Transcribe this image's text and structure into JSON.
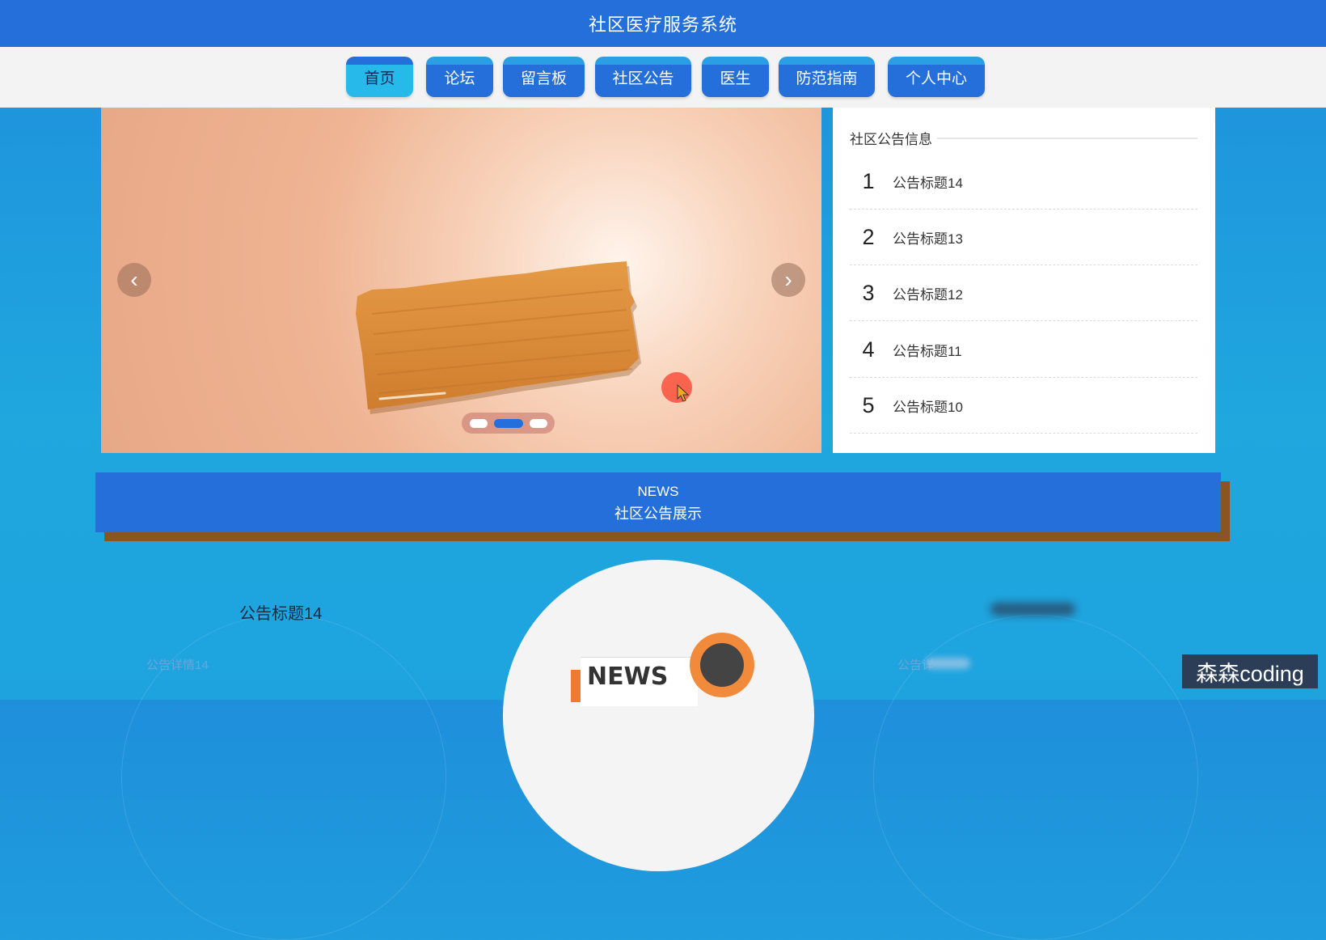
{
  "app": {
    "title": "社区医疗服务系统"
  },
  "nav": {
    "items": [
      {
        "label": "首页",
        "active": true
      },
      {
        "label": "论坛"
      },
      {
        "label": "留言板"
      },
      {
        "label": "社区公告"
      },
      {
        "label": "医生"
      },
      {
        "label": "防范指南"
      },
      {
        "label": "个人中心"
      }
    ]
  },
  "carousel": {
    "prev_icon": "chevron-left-icon",
    "next_icon": "chevron-right-icon",
    "slide_count": 3,
    "active_slide": 2
  },
  "notice_panel": {
    "header": "社区公告信息",
    "items": [
      {
        "num": "1",
        "title": "公告标题14"
      },
      {
        "num": "2",
        "title": "公告标题13"
      },
      {
        "num": "3",
        "title": "公告标题12"
      },
      {
        "num": "4",
        "title": "公告标题11"
      },
      {
        "num": "5",
        "title": "公告标题10"
      }
    ]
  },
  "news_section": {
    "en": "NEWS",
    "zh": "社区公告展示"
  },
  "news_cards": {
    "left_title": "公告标题14",
    "left_detail": "公告详情14",
    "right_detail": "公告详",
    "illustration_text": "NEWS"
  },
  "watermark": "森森coding",
  "colors": {
    "primary": "#246fd9",
    "active_nav": "#27b9e9",
    "banner_shadow": "#8b5522",
    "page_bg": "#1ea3df"
  }
}
